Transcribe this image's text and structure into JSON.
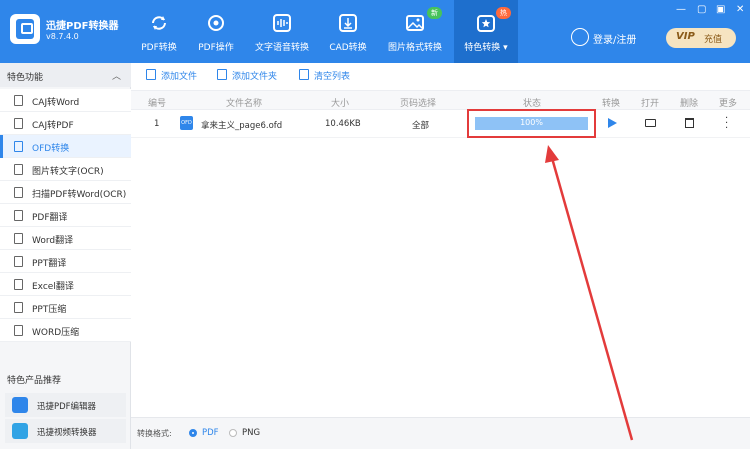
{
  "app": {
    "name": "迅捷PDF转换器",
    "version": "v8.7.4.0"
  },
  "nav": {
    "tabs": [
      {
        "label": "PDF转换"
      },
      {
        "label": "PDF操作"
      },
      {
        "label": "文字语音转换"
      },
      {
        "label": "CAD转换"
      },
      {
        "label": "图片格式转换",
        "badge": "新"
      },
      {
        "label": "特色转换",
        "badge": "热"
      }
    ],
    "login_label": "登录/注册",
    "vip_label": "VIP",
    "recharge_label": "充值"
  },
  "sidebar": {
    "header": "特色功能",
    "items": [
      {
        "label": "CAJ转Word"
      },
      {
        "label": "CAJ转PDF"
      },
      {
        "label": "OFD转换"
      },
      {
        "label": "图片转文字(OCR)"
      },
      {
        "label": "扫描PDF转Word(OCR)"
      },
      {
        "label": "PDF翻译"
      },
      {
        "label": "Word翻译"
      },
      {
        "label": "PPT翻译"
      },
      {
        "label": "Excel翻译"
      },
      {
        "label": "PPT压缩"
      },
      {
        "label": "WORD压缩"
      }
    ],
    "active_index": 2,
    "products_header": "特色产品推荐",
    "products": [
      {
        "label": "迅捷PDF编辑器"
      },
      {
        "label": "迅捷视频转换器"
      }
    ]
  },
  "toolbar": {
    "add_file": "添加文件",
    "add_folder": "添加文件夹",
    "clear_list": "清空列表"
  },
  "table": {
    "headers": [
      "编号",
      "文件名称",
      "大小",
      "页码选择",
      "状态",
      "转换",
      "打开",
      "删除",
      "更多"
    ],
    "rows": [
      {
        "index": "1",
        "file_icon": "OFD",
        "file_name": "拿来主义_page6.ofd",
        "size": "10.46KB",
        "pages": "全部",
        "status": "100%",
        "progress": 1.0
      }
    ]
  },
  "footer": {
    "format_label": "转换格式:",
    "options": [
      "PDF",
      "PNG"
    ],
    "selected": "PDF"
  },
  "colors": {
    "brand": "#2f86ea",
    "highlight": "#e33b3b"
  }
}
